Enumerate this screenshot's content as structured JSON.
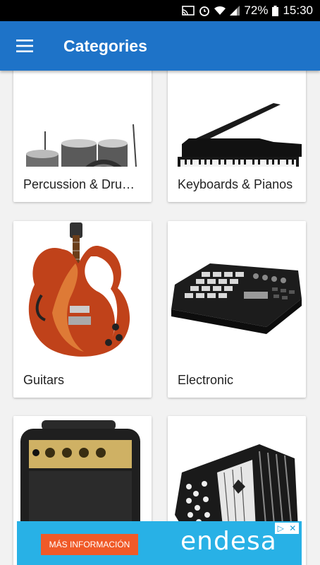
{
  "status_bar": {
    "battery_percent": "72%",
    "time": "15:30",
    "icons": [
      "cast-icon",
      "alarm-icon",
      "wifi-icon",
      "signal-icon",
      "battery-icon"
    ]
  },
  "app_bar": {
    "title": "Categories",
    "menu_icon": "hamburger-menu-icon",
    "color": "#1e73c8"
  },
  "categories": [
    {
      "label": "Percussion & Dru…",
      "image": "drum-kit"
    },
    {
      "label": "Keyboards & Pianos",
      "image": "grand-piano"
    },
    {
      "label": "Guitars",
      "image": "electric-guitar"
    },
    {
      "label": "Electronic",
      "image": "midi-controller"
    },
    {
      "label": "",
      "image": "guitar-amplifier"
    },
    {
      "label": "",
      "image": "accordion"
    }
  ],
  "ad": {
    "button_label": "MÁS INFORMACIÓN",
    "brand": "endesa",
    "icons": [
      "adchoices-icon",
      "close-icon"
    ],
    "background": "#28b1e6",
    "button_color": "#f05a28"
  }
}
